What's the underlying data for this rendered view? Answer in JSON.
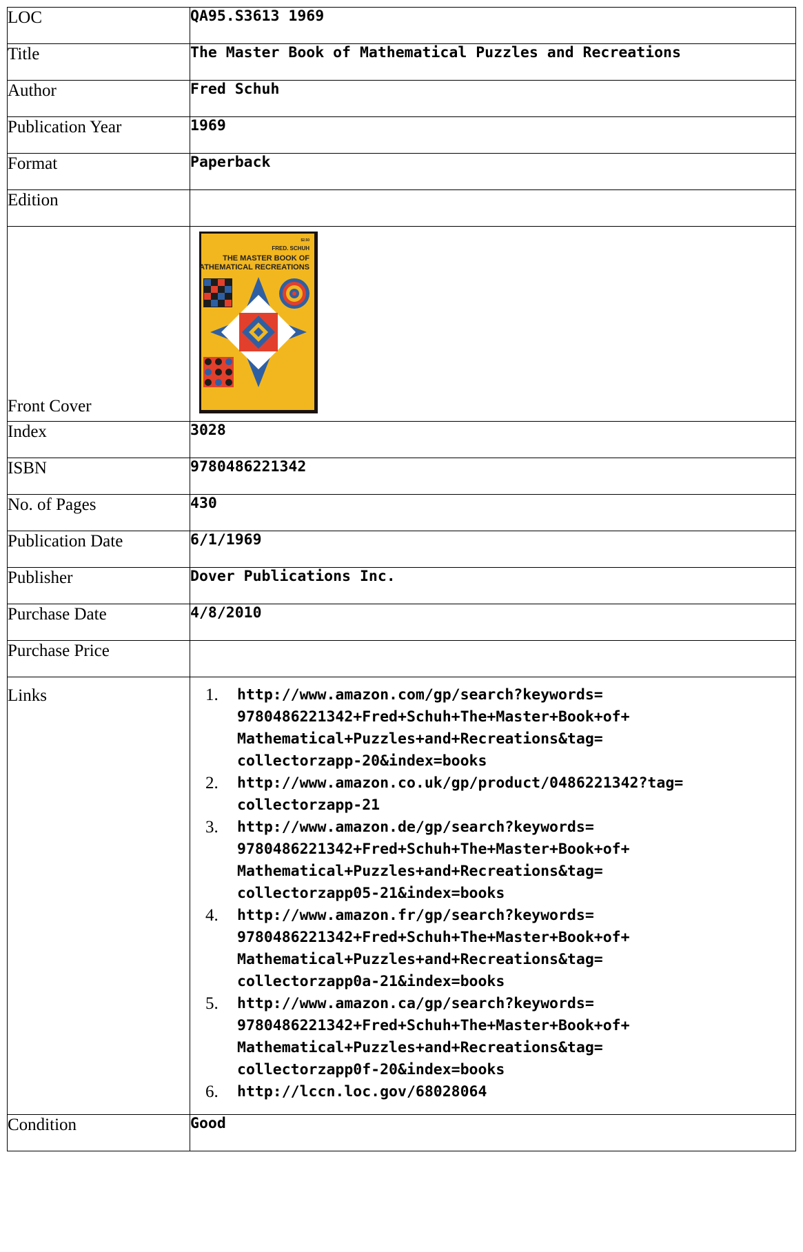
{
  "rows": [
    {
      "label": "LOC",
      "value": "QA95.S3613 1969"
    },
    {
      "label": "Title",
      "value": "The Master Book of Mathematical Puzzles and Recreations"
    },
    {
      "label": "Author",
      "value": "Fred Schuh"
    },
    {
      "label": "Publication Year",
      "value": "1969"
    },
    {
      "label": "Format",
      "value": "Paperback"
    },
    {
      "label": "Edition",
      "value": ""
    },
    {
      "label": "Front Cover",
      "value": ""
    },
    {
      "label": "Index",
      "value": "3028"
    },
    {
      "label": "ISBN",
      "value": "9780486221342"
    },
    {
      "label": "No. of Pages",
      "value": "430"
    },
    {
      "label": "Publication Date",
      "value": "6/1/1969"
    },
    {
      "label": "Publisher",
      "value": "Dover Publications Inc."
    },
    {
      "label": "Purchase Date",
      "value": "4/8/2010"
    },
    {
      "label": "Purchase Price",
      "value": ""
    },
    {
      "label": "Links",
      "value": ""
    },
    {
      "label": "Condition",
      "value": "Good"
    }
  ],
  "cover": {
    "author": "FRED. SCHUH",
    "title_line1": "THE MASTER BOOK OF",
    "title_line2": "MATHEMATICAL RECREATIONS",
    "code": "$2.50",
    "bg_color": "#f2b71f",
    "accent_red": "#e2402c",
    "accent_blue": "#2f5fa3"
  },
  "links": [
    {
      "number": "1.",
      "lines": [
        "http://www.amazon.com/gp/search?keywords=",
        "9780486221342+Fred+Schuh+The+Master+Book+of+",
        "Mathematical+Puzzles+and+Recreations&tag=",
        "collectorzapp-20&index=books"
      ]
    },
    {
      "number": "2.",
      "lines": [
        "http://www.amazon.co.uk/gp/product/0486221342?tag=",
        "collectorzapp-21"
      ]
    },
    {
      "number": "3.",
      "lines": [
        "http://www.amazon.de/gp/search?keywords=",
        "9780486221342+Fred+Schuh+The+Master+Book+of+",
        "Mathematical+Puzzles+and+Recreations&tag=",
        "collectorzapp05-21&index=books"
      ]
    },
    {
      "number": "4.",
      "lines": [
        "http://www.amazon.fr/gp/search?keywords=",
        "9780486221342+Fred+Schuh+The+Master+Book+of+",
        "Mathematical+Puzzles+and+Recreations&tag=",
        "collectorzapp0a-21&index=books"
      ]
    },
    {
      "number": "5.",
      "lines": [
        "http://www.amazon.ca/gp/search?keywords=",
        "9780486221342+Fred+Schuh+The+Master+Book+of+",
        "Mathematical+Puzzles+and+Recreations&tag=",
        "collectorzapp0f-20&index=books"
      ]
    },
    {
      "number": "6.",
      "lines": [
        "http://lccn.loc.gov/68028064"
      ]
    }
  ]
}
